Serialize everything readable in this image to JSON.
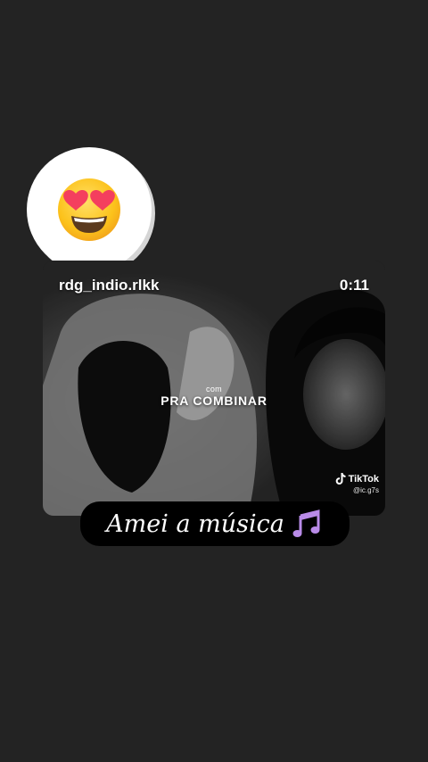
{
  "reaction": {
    "emoji": "heart-eyes-face-emoji"
  },
  "video": {
    "username": "rdg_indio.rlkk",
    "duration": "0:11",
    "overlay_small": "com",
    "overlay_title": "PRA COMBINAR",
    "watermark_brand": "TikTok",
    "watermark_handle": "@ic.g7s"
  },
  "caption": {
    "text": "Amei a música",
    "emoji": "musical-notes-emoji"
  },
  "colors": {
    "background": "#232323",
    "caption_bg": "#000000",
    "sticker_bg": "#ffffff",
    "notes": "#b98be8"
  }
}
